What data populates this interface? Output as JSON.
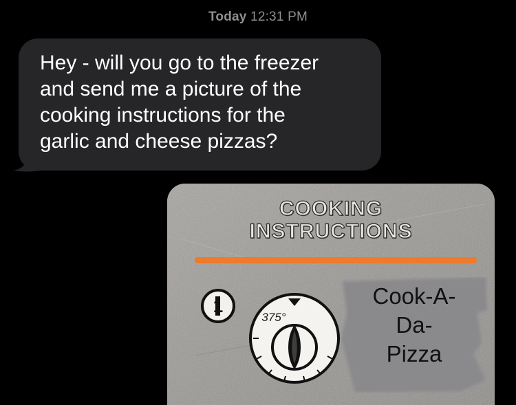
{
  "conversation": {
    "timestamp_day": "Today",
    "timestamp_time": "12:31 PM"
  },
  "message": {
    "lines": [
      "Hey - will you go to the freezer",
      "and send me a picture of the",
      "cooking instructions for the",
      "garlic and cheese pizzas?"
    ]
  },
  "attachment": {
    "heading_line1": "COOKING",
    "heading_line2": "INSTRUCTIONS",
    "step_number": "1",
    "temperature": "375°",
    "sticker_lines": [
      "Cook-A-",
      "Da-",
      "Pizza"
    ],
    "colors": {
      "orange_rule": "#f07a2a",
      "background": "#9a9894",
      "sticker": "#8a8a8d"
    }
  }
}
